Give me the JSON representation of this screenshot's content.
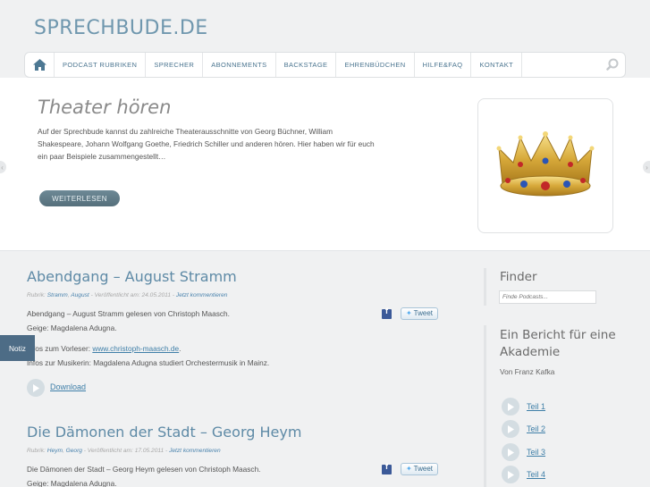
{
  "site": {
    "logo": "SPRECHBUDE.DE"
  },
  "nav": {
    "home_icon": "home-icon",
    "items": [
      "PODCAST RUBRIKEN",
      "SPRECHER",
      "ABONNEMENTS",
      "BACKSTAGE",
      "EHRENBÜDCHEN",
      "HILFE&FAQ",
      "KONTAKT"
    ],
    "search_icon": "search-icon"
  },
  "hero": {
    "title": "Theater hören",
    "text": "Auf der Sprechbude kannst du zahlreiche Theaterausschnitte von Georg Büchner, William Shakespeare, Johann Wolfgang Goethe, Friedrich Schiller und anderen hören. Hier haben wir für euch ein paar Beispiele zusammengestellt…",
    "button": "WEITERLESEN",
    "image": "crown-image"
  },
  "posts": [
    {
      "title": "Abendgang – August Stramm",
      "meta_prefix": "Rubrik: ",
      "meta_tag1": "Stramm",
      "meta_tag2": "August",
      "meta_published": " - Veröffentlicht am: 24.05.2011 - ",
      "meta_comment": "Jetzt kommentieren",
      "line1": "Abendgang – August Stramm gelesen von Christoph Maasch.",
      "line2": "Geige: Magdalena Adugna.",
      "line3_prefix": "Infos zum Vorleser: ",
      "line3_link": "www.christoph-maasch.de",
      "line3_suffix": ".",
      "line4": "Infos zur Musikerin: Magdalena Adugna studiert Orchestermusik in Mainz.",
      "download": "Download",
      "tweet": "Tweet"
    },
    {
      "title": "Die Dämonen der Stadt – Georg Heym",
      "meta_prefix": "Rubrik: ",
      "meta_tag1": "Heym",
      "meta_tag2": "Georg",
      "meta_published": " - Veröffentlicht am: 17.05.2011 - ",
      "meta_comment": "Jetzt kommentieren",
      "line1": "Die Dämonen der Stadt – Georg Heym gelesen von Christoph Maasch.",
      "line2": "Geige: Magdalena Adugna.",
      "tweet": "Tweet"
    }
  ],
  "sidebar": {
    "finder_title": "Finder",
    "finder_placeholder": "Finde Podcasts...",
    "feature_title": "Ein Bericht für eine Akademie",
    "feature_author": "Von Franz Kafka",
    "parts": [
      "Teil 1",
      "Teil 2",
      "Teil 3",
      "Teil 4"
    ]
  },
  "notiz": "Notiz"
}
